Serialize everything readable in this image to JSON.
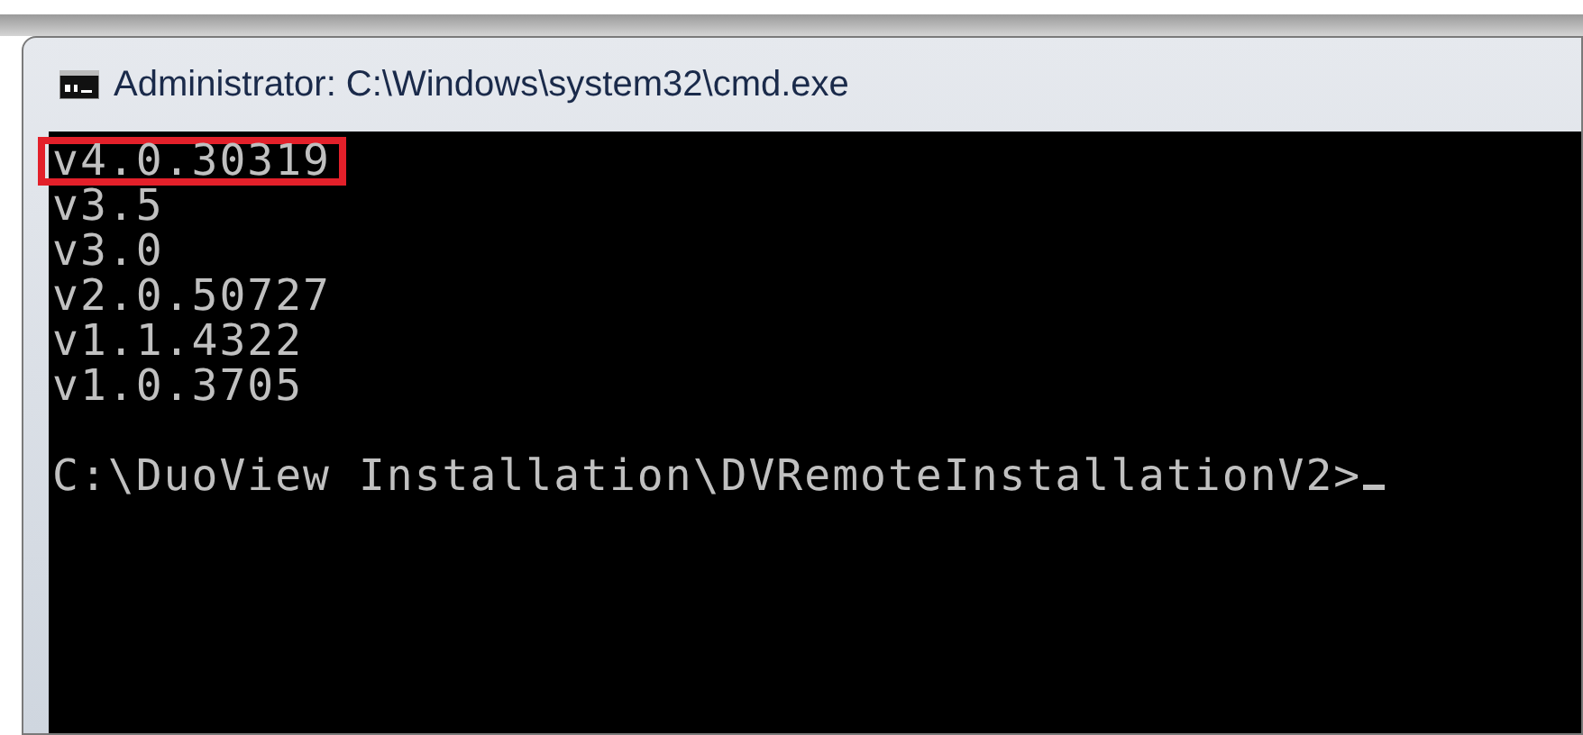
{
  "window": {
    "title": "Administrator: C:\\Windows\\system32\\cmd.exe"
  },
  "console": {
    "lines": [
      {
        "kind": "text",
        "text": "v4.0.30319",
        "highlighted": true
      },
      {
        "kind": "text",
        "text": "v3.5",
        "highlighted": false
      },
      {
        "kind": "text",
        "text": "v3.0",
        "highlighted": false
      },
      {
        "kind": "text",
        "text": "v2.0.50727",
        "highlighted": false
      },
      {
        "kind": "text",
        "text": "v1.1.4322",
        "highlighted": false
      },
      {
        "kind": "text",
        "text": "v1.0.3705",
        "highlighted": false
      },
      {
        "kind": "blank"
      },
      {
        "kind": "prompt",
        "text": "C:\\DuoView Installation\\DVRemoteInstallationV2>"
      }
    ]
  }
}
